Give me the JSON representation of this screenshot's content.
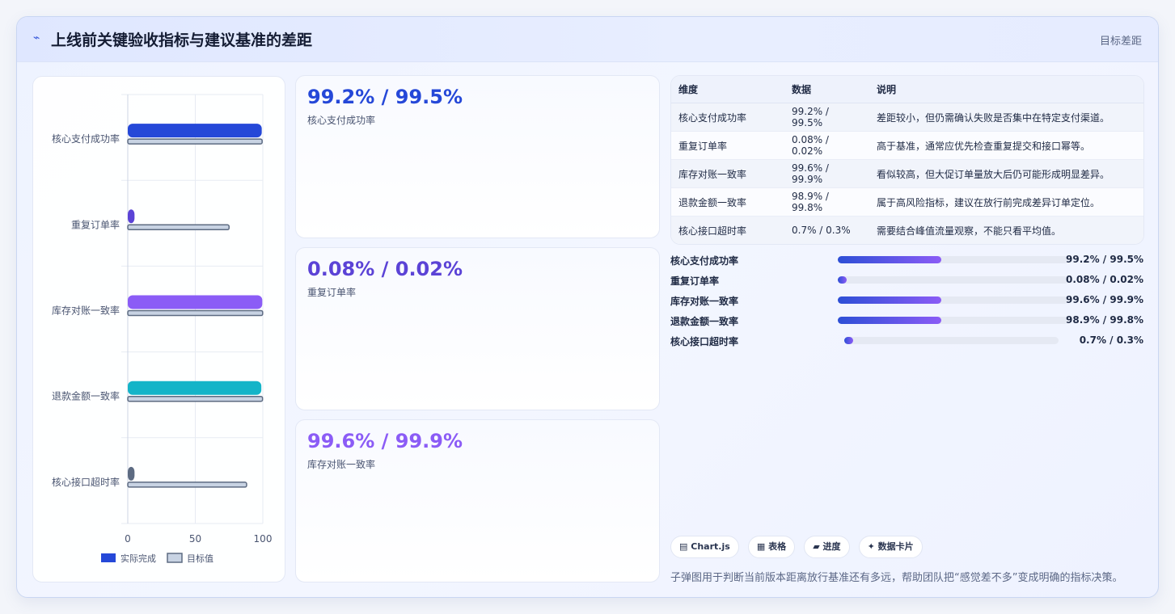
{
  "header": {
    "icon": "pulse-icon",
    "title": "上线前关键验收指标与建议基准的差距",
    "tag": "目标差距"
  },
  "colors": {
    "blue": "#2548d8",
    "indigo": "#5b43d6",
    "violet": "#8b5cf6",
    "cyan": "#14b4c8",
    "slate": "#5d6b82",
    "target_fill": "#c8d3e3",
    "target_stroke": "#5d6b82"
  },
  "chart_data": {
    "type": "bar",
    "orientation": "horizontal",
    "categories": [
      "核心支付成功率",
      "重复订单率",
      "库存对账一致率",
      "退款金额一致率",
      "核心接口超时率"
    ],
    "series": [
      {
        "name": "实际完成",
        "values": [
          99.2,
          5,
          99.6,
          98.9,
          5
        ]
      },
      {
        "name": "目标值",
        "values": [
          99.5,
          75,
          99.9,
          99.8,
          88
        ]
      }
    ],
    "xticks": [
      "0",
      "50",
      "100"
    ],
    "xlim": [
      0,
      100
    ],
    "grid": true,
    "legend": "bottom"
  },
  "stat_cards": [
    {
      "value": "99.2% / 99.5%",
      "label": "核心支付成功率",
      "color": "#2548d8"
    },
    {
      "value": "0.08% / 0.02%",
      "label": "重复订单率",
      "color": "#5b43d6"
    },
    {
      "value": "99.6% / 99.9%",
      "label": "库存对账一致率",
      "color": "#8b5cf6"
    }
  ],
  "table": {
    "headers": [
      "维度",
      "数据",
      "说明"
    ],
    "rows": [
      [
        "核心支付成功率",
        "99.2% / 99.5%",
        "差距较小，但仍需确认失败是否集中在特定支付渠道。"
      ],
      [
        "重复订单率",
        "0.08% / 0.02%",
        "高于基准，通常应优先检查重复提交和接口幂等。"
      ],
      [
        "库存对账一致率",
        "99.6% / 99.9%",
        "看似较高，但大促订单量放大后仍可能形成明显差异。"
      ],
      [
        "退款金额一致率",
        "98.9% / 99.8%",
        "属于高风险指标，建议在放行前完成差异订单定位。"
      ],
      [
        "核心接口超时率",
        "0.7% / 0.3%",
        "需要结合峰值流量观察，不能只看平均值。"
      ]
    ]
  },
  "progress": [
    {
      "label": "核心支付成功率",
      "value": "99.2% / 99.5%",
      "fill": 0.45
    },
    {
      "label": "重复订单率",
      "value": "0.08% / 0.02%",
      "fill": 0.04
    },
    {
      "label": "库存对账一致率",
      "value": "99.6% / 99.9%",
      "fill": 0.45
    },
    {
      "label": "退款金额一致率",
      "value": "98.9% / 99.8%",
      "fill": 0.45
    },
    {
      "label": "核心接口超时率",
      "value": "0.7% / 0.3%",
      "fill": 0.04
    }
  ],
  "chips": [
    {
      "icon": "chart-icon",
      "glyph": "▤",
      "label": "Chart.js"
    },
    {
      "icon": "table-icon",
      "glyph": "▦",
      "label": "表格"
    },
    {
      "icon": "progress-icon",
      "glyph": "▰",
      "label": "进度"
    },
    {
      "icon": "sparkle-icon",
      "glyph": "✦",
      "label": "数据卡片"
    }
  ],
  "footnote": "子弹图用于判断当前版本距离放行基准还有多远，帮助团队把“感觉差不多”变成明确的指标决策。"
}
